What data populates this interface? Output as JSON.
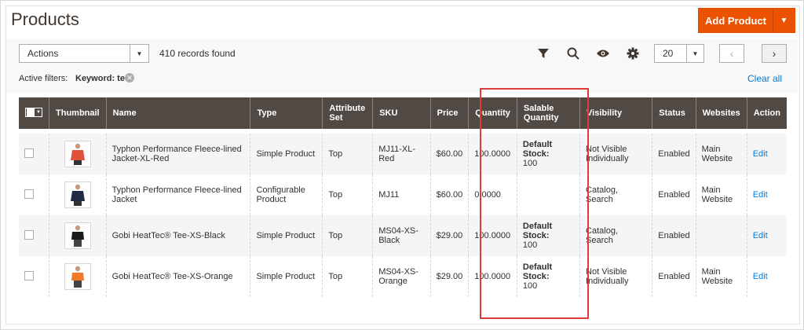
{
  "page": {
    "title": "Products"
  },
  "header": {
    "add_product_label": "Add Product"
  },
  "toolbar": {
    "actions_label": "Actions",
    "records_found": "410 records found",
    "per_page": "20",
    "icons": [
      "filter-icon",
      "search-icon",
      "eye-icon",
      "gear-icon"
    ]
  },
  "filters": {
    "active_label": "Active filters:",
    "keyword": "Keyword: tee",
    "clear_all": "Clear all"
  },
  "grid": {
    "columns": [
      "Thumbnail",
      "Name",
      "Type",
      "Attribute Set",
      "SKU",
      "Price",
      "Quantity",
      "Salable Quantity",
      "Visibility",
      "Status",
      "Websites",
      "Action"
    ],
    "rows": [
      {
        "name": "Typhon Performance Fleece-lined Jacket-XL-Red",
        "type": "Simple Product",
        "attribute_set": "Top",
        "sku": "MJ11-XL-Red",
        "price": "$60.00",
        "quantity": "100.0000",
        "salable_label": "Default Stock:",
        "salable_value": "100",
        "visibility": "Not Visible Individually",
        "status": "Enabled",
        "websites": "Main Website",
        "action": "Edit",
        "thumb_color": "#e0533a"
      },
      {
        "name": "Typhon Performance Fleece-lined Jacket",
        "type": "Configurable Product",
        "attribute_set": "Top",
        "sku": "MJ11",
        "price": "$60.00",
        "quantity": "0.0000",
        "salable_label": "",
        "salable_value": "",
        "visibility": "Catalog, Search",
        "status": "Enabled",
        "websites": "Main Website",
        "action": "Edit",
        "thumb_color": "#1f2a44"
      },
      {
        "name": "Gobi HeatTec® Tee-XS-Black",
        "type": "Simple Product",
        "attribute_set": "Top",
        "sku": "MS04-XS-Black",
        "price": "$29.00",
        "quantity": "100.0000",
        "salable_label": "Default Stock:",
        "salable_value": "100",
        "visibility": "Catalog, Search",
        "status": "Enabled",
        "websites": "",
        "action": "Edit",
        "thumb_color": "#1a1a1a"
      },
      {
        "name": "Gobi HeatTec® Tee-XS-Orange",
        "type": "Simple Product",
        "attribute_set": "Top",
        "sku": "MS04-XS-Orange",
        "price": "$29.00",
        "quantity": "100.0000",
        "salable_label": "Default Stock:",
        "salable_value": "100",
        "visibility": "Not Visible Individually",
        "status": "Enabled",
        "websites": "Main Website",
        "action": "Edit",
        "thumb_color": "#f07a2a"
      }
    ]
  },
  "colors": {
    "accent": "#eb5202",
    "header_bg": "#514943",
    "link": "#007bdb",
    "highlight": "#e03a3a"
  }
}
